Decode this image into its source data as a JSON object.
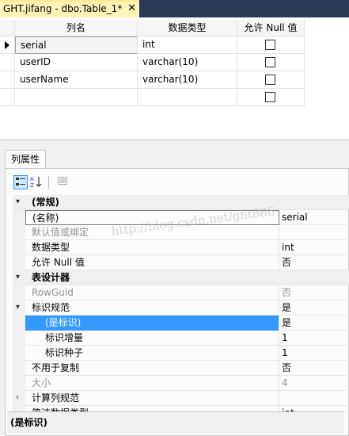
{
  "doc_tab": {
    "title": "GHT.jifang - dbo.Table_1*",
    "close": "✕"
  },
  "grid": {
    "headers": [
      "列名",
      "数据类型",
      "允许 Null 值"
    ],
    "rows": [
      {
        "name": "serial",
        "type": "int",
        "allow_null": false,
        "current": true
      },
      {
        "name": "userID",
        "type": "varchar(10)",
        "allow_null": false
      },
      {
        "name": "userName",
        "type": "varchar(10)",
        "allow_null": false
      },
      {
        "name": "",
        "type": "",
        "allow_null": false
      }
    ]
  },
  "panel": {
    "tab_label": "列属性",
    "toolbar": {
      "categorized_icon": "categorized-icon",
      "alpha_icon": "alphabetical-sort-icon",
      "pages_icon": "property-pages-icon"
    },
    "categories": {
      "general": "(常规)",
      "table_designer": "表设计器",
      "computed": "计算列规范",
      "partial": "简洁数据类型"
    },
    "props": {
      "name": {
        "label": "(名称)",
        "value": "serial"
      },
      "default": {
        "label": "默认值或绑定",
        "value": ""
      },
      "datatype": {
        "label": "数据类型",
        "value": "int"
      },
      "allownull": {
        "label": "允许 Null 值",
        "value": "否"
      },
      "rowguid": {
        "label": "RowGuid",
        "value": "否"
      },
      "identity_spec": {
        "label": "标识规范",
        "value": "是"
      },
      "is_identity": {
        "label": "(是标识)",
        "value": "是"
      },
      "increment": {
        "label": "标识增量",
        "value": "1"
      },
      "seed": {
        "label": "标识种子",
        "value": "1"
      },
      "notrepl": {
        "label": "不用于复制",
        "value": "否"
      },
      "size": {
        "label": "大小",
        "value": "4"
      },
      "partial_value": "int"
    },
    "description": "(是标识)",
    "watermark": "http://blog.csdn.net/ght886"
  }
}
